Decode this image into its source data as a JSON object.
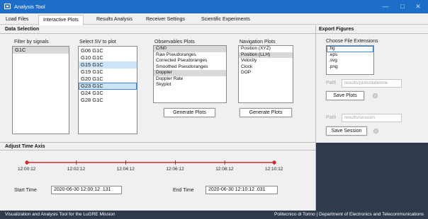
{
  "window": {
    "title": "Analysis Tool"
  },
  "tabs": [
    "Load Files",
    "Interactive Plots",
    "Results Analysis",
    "Receiver Settings",
    "Scientific Experiments"
  ],
  "data_selection": {
    "title": "Data Selection",
    "filter_label": "Filter by signals",
    "filter_items": [
      "G1C"
    ],
    "sv_label": "Select SV to plot",
    "sv_items": [
      "G06 G1C",
      "G10 G1C",
      "G15 G1C",
      "G19 G1C",
      "G20 G1C",
      "G23 G1C",
      "G24 G1C",
      "G28 G1C"
    ],
    "observables_label": "Observables Plots",
    "observables_items": [
      "C/N0",
      "Raw Pseudoranges",
      "Corrected Pseudoranges",
      "Smoothed Pseudoranges",
      "Doppler",
      "Doppler Rate",
      "Skyplot"
    ],
    "navigation_label": "Navigation Plots",
    "navigation_items": [
      "Position (XYZ)",
      "Position (LLH)",
      "Velocity",
      "Clock",
      "DOP"
    ],
    "generate_label": "Generate Plots"
  },
  "export": {
    "title": "Export Figures",
    "choose_label": "Choose File Extensions",
    "extensions": [
      ".fig",
      ".eps",
      ".svg",
      ".png"
    ],
    "path_label": "Path",
    "plots_path_placeholder": "results/plots/datetime",
    "save_plots_label": "Save Plots",
    "session_path_placeholder": "results/session",
    "save_session_label": "Save Session"
  },
  "time_axis": {
    "title": "Adjust Time Axis",
    "ticks": [
      "12:00:12",
      "12:02:12",
      "12:04:12",
      "12:06:12",
      "12:08:12",
      "12:10:12"
    ],
    "start_label": "Start Time",
    "start_value": "2020-06-30  12:00:12 .131",
    "end_label": "End Time",
    "end_value": "2020-06-30  12:10:12 .031",
    "accent_color": "#d9282f"
  },
  "status": {
    "left": "Visualization and Analysis Tool for the LuGRE Mission",
    "right": "Politecnico di Torino | Department of Electronics and Telecommunications"
  }
}
